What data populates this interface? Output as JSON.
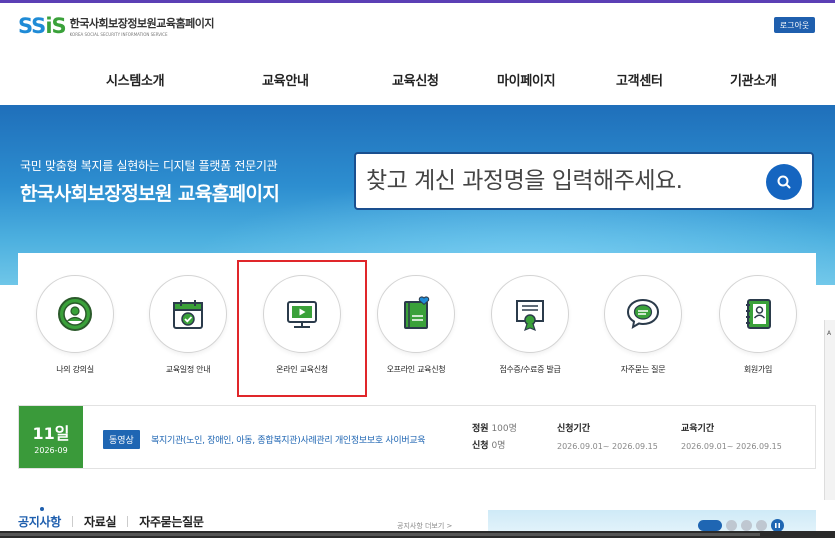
{
  "header": {
    "logo_mark": "SS",
    "logo_mark_accent": "iS",
    "logo_text": "한국사회보장정보원교육홈페이지",
    "logo_sub": "KOREA SOCIAL SECURITY INFORMATION SERVICE",
    "logout_label": "로그아웃"
  },
  "nav": {
    "items": [
      {
        "label": "시스템소개"
      },
      {
        "label": "교육안내"
      },
      {
        "label": "교육신청"
      },
      {
        "label": "마이페이지"
      },
      {
        "label": "고객센터"
      },
      {
        "label": "기관소개"
      }
    ]
  },
  "hero": {
    "subtitle": "국민 맞춤형 복지를 실현하는 디지털 플랫폼 전문기관",
    "title": "한국사회보장정보원 교육홈페이지",
    "search_placeholder": "찾고 계신 과정명을 입력해주세요."
  },
  "quick_menu": {
    "items": [
      {
        "label": "나의 강의실",
        "icon": "user-circle-icon"
      },
      {
        "label": "교육일정 안내",
        "icon": "calendar-check-icon"
      },
      {
        "label": "온라인 교육신청",
        "icon": "monitor-play-icon"
      },
      {
        "label": "오프라인 교육신청",
        "icon": "book-heart-icon"
      },
      {
        "label": "접수증/수료증 발급",
        "icon": "certificate-icon"
      },
      {
        "label": "자주묻는 질문",
        "icon": "chat-bubble-icon"
      },
      {
        "label": "회원가입",
        "icon": "contact-book-icon"
      }
    ],
    "highlighted_index": 2
  },
  "course": {
    "day": "11일",
    "year_month": "2026-09",
    "tag": "동영상",
    "title": "복지기관(노인, 장애인, 아동, 종합복지관)사례관리 개인정보보호 사이버교육",
    "capacity_label": "정원",
    "capacity_value": "100명",
    "applied_label": "신청",
    "applied_value": "0명",
    "apply_period_label": "신청기간",
    "apply_period_value": "2026.09.01~ 2026.09.15",
    "edu_period_label": "교육기간",
    "edu_period_value": "2026.09.01~ 2026.09.15"
  },
  "board": {
    "tabs": [
      {
        "label": "공지사항"
      },
      {
        "label": "자료실"
      },
      {
        "label": "자주묻는질문"
      }
    ],
    "more_label": "공지사항 더보기 >"
  },
  "side_label": "A",
  "colors": {
    "brand_blue": "#1f5fae",
    "brand_green": "#3a9a3a",
    "highlight_red": "#e0262a",
    "icon_green": "#3aa13a"
  }
}
